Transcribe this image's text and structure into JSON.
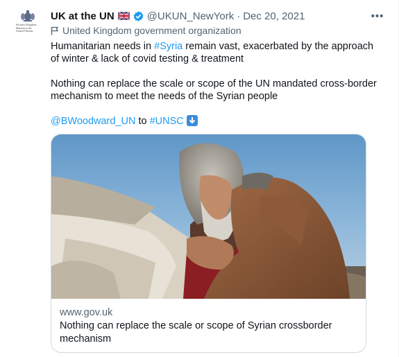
{
  "author": {
    "avatar_lines": [
      "Security Kingdom",
      "Mission to the",
      "United Nations"
    ],
    "name": "UK at the UN",
    "flag_icon": "uk-flag-icon",
    "verified_icon": "verified-badge-icon",
    "handle": "@UKUN_NewYork",
    "separator": "·",
    "date": "Dec 20, 2021",
    "label": "United Kingdom government organization"
  },
  "tweet": {
    "line1_prefix": "Humanitarian needs in ",
    "line1_hashtag": "#Syria",
    "line1_suffix": " remain vast, exacerbated by the approach of winter & lack of covid testing & treatment",
    "paragraph2": "Nothing can replace the scale or scope of the UN mandated cross-border mechanism to meet the needs of the Syrian people",
    "mention": "@BWoodward_UN",
    "to": " to ",
    "hashtag2": "#UNSC"
  },
  "card": {
    "domain": "www.gov.uk",
    "title": "Nothing can replace the scale or scope of Syrian crossborder mechanism"
  },
  "colors": {
    "link": "#1d9bf0",
    "secondary_text": "#536471",
    "border": "#cfd9de"
  }
}
